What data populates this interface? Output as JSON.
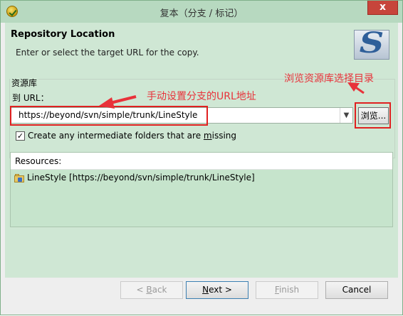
{
  "window": {
    "title": "复本（分支 / 标记）",
    "close_label": "x"
  },
  "banner": {
    "title": "Repository Location",
    "description": "Enter or select the target URL for the copy."
  },
  "repository": {
    "group_label": "资源库",
    "url_label": "到 URL：",
    "url_value": "https://beyond/svn/simple/trunk/LineStyle",
    "dropdown_icon": "chevron-down-icon",
    "browse_label": "浏览...",
    "create_folders": {
      "checked": true,
      "label": "Create any intermediate folders that are missing"
    }
  },
  "resources": {
    "header": "Resources:",
    "items": [
      {
        "text": "LineStyle [https://beyond/svn/simple/trunk/LineStyle]",
        "icon": "svn-folder-icon"
      }
    ]
  },
  "buttons": {
    "back": "< Back",
    "next": "Next >",
    "finish": "Finish",
    "cancel": "Cancel"
  },
  "annotations": {
    "browse_note": "浏览资源库选择目录",
    "url_note": "手动设置分支的URL地址",
    "color": "#e8323a"
  },
  "colors": {
    "titlebar": "#b7d9c0",
    "panel": "#cfe7d4",
    "close": "#c7453b"
  }
}
